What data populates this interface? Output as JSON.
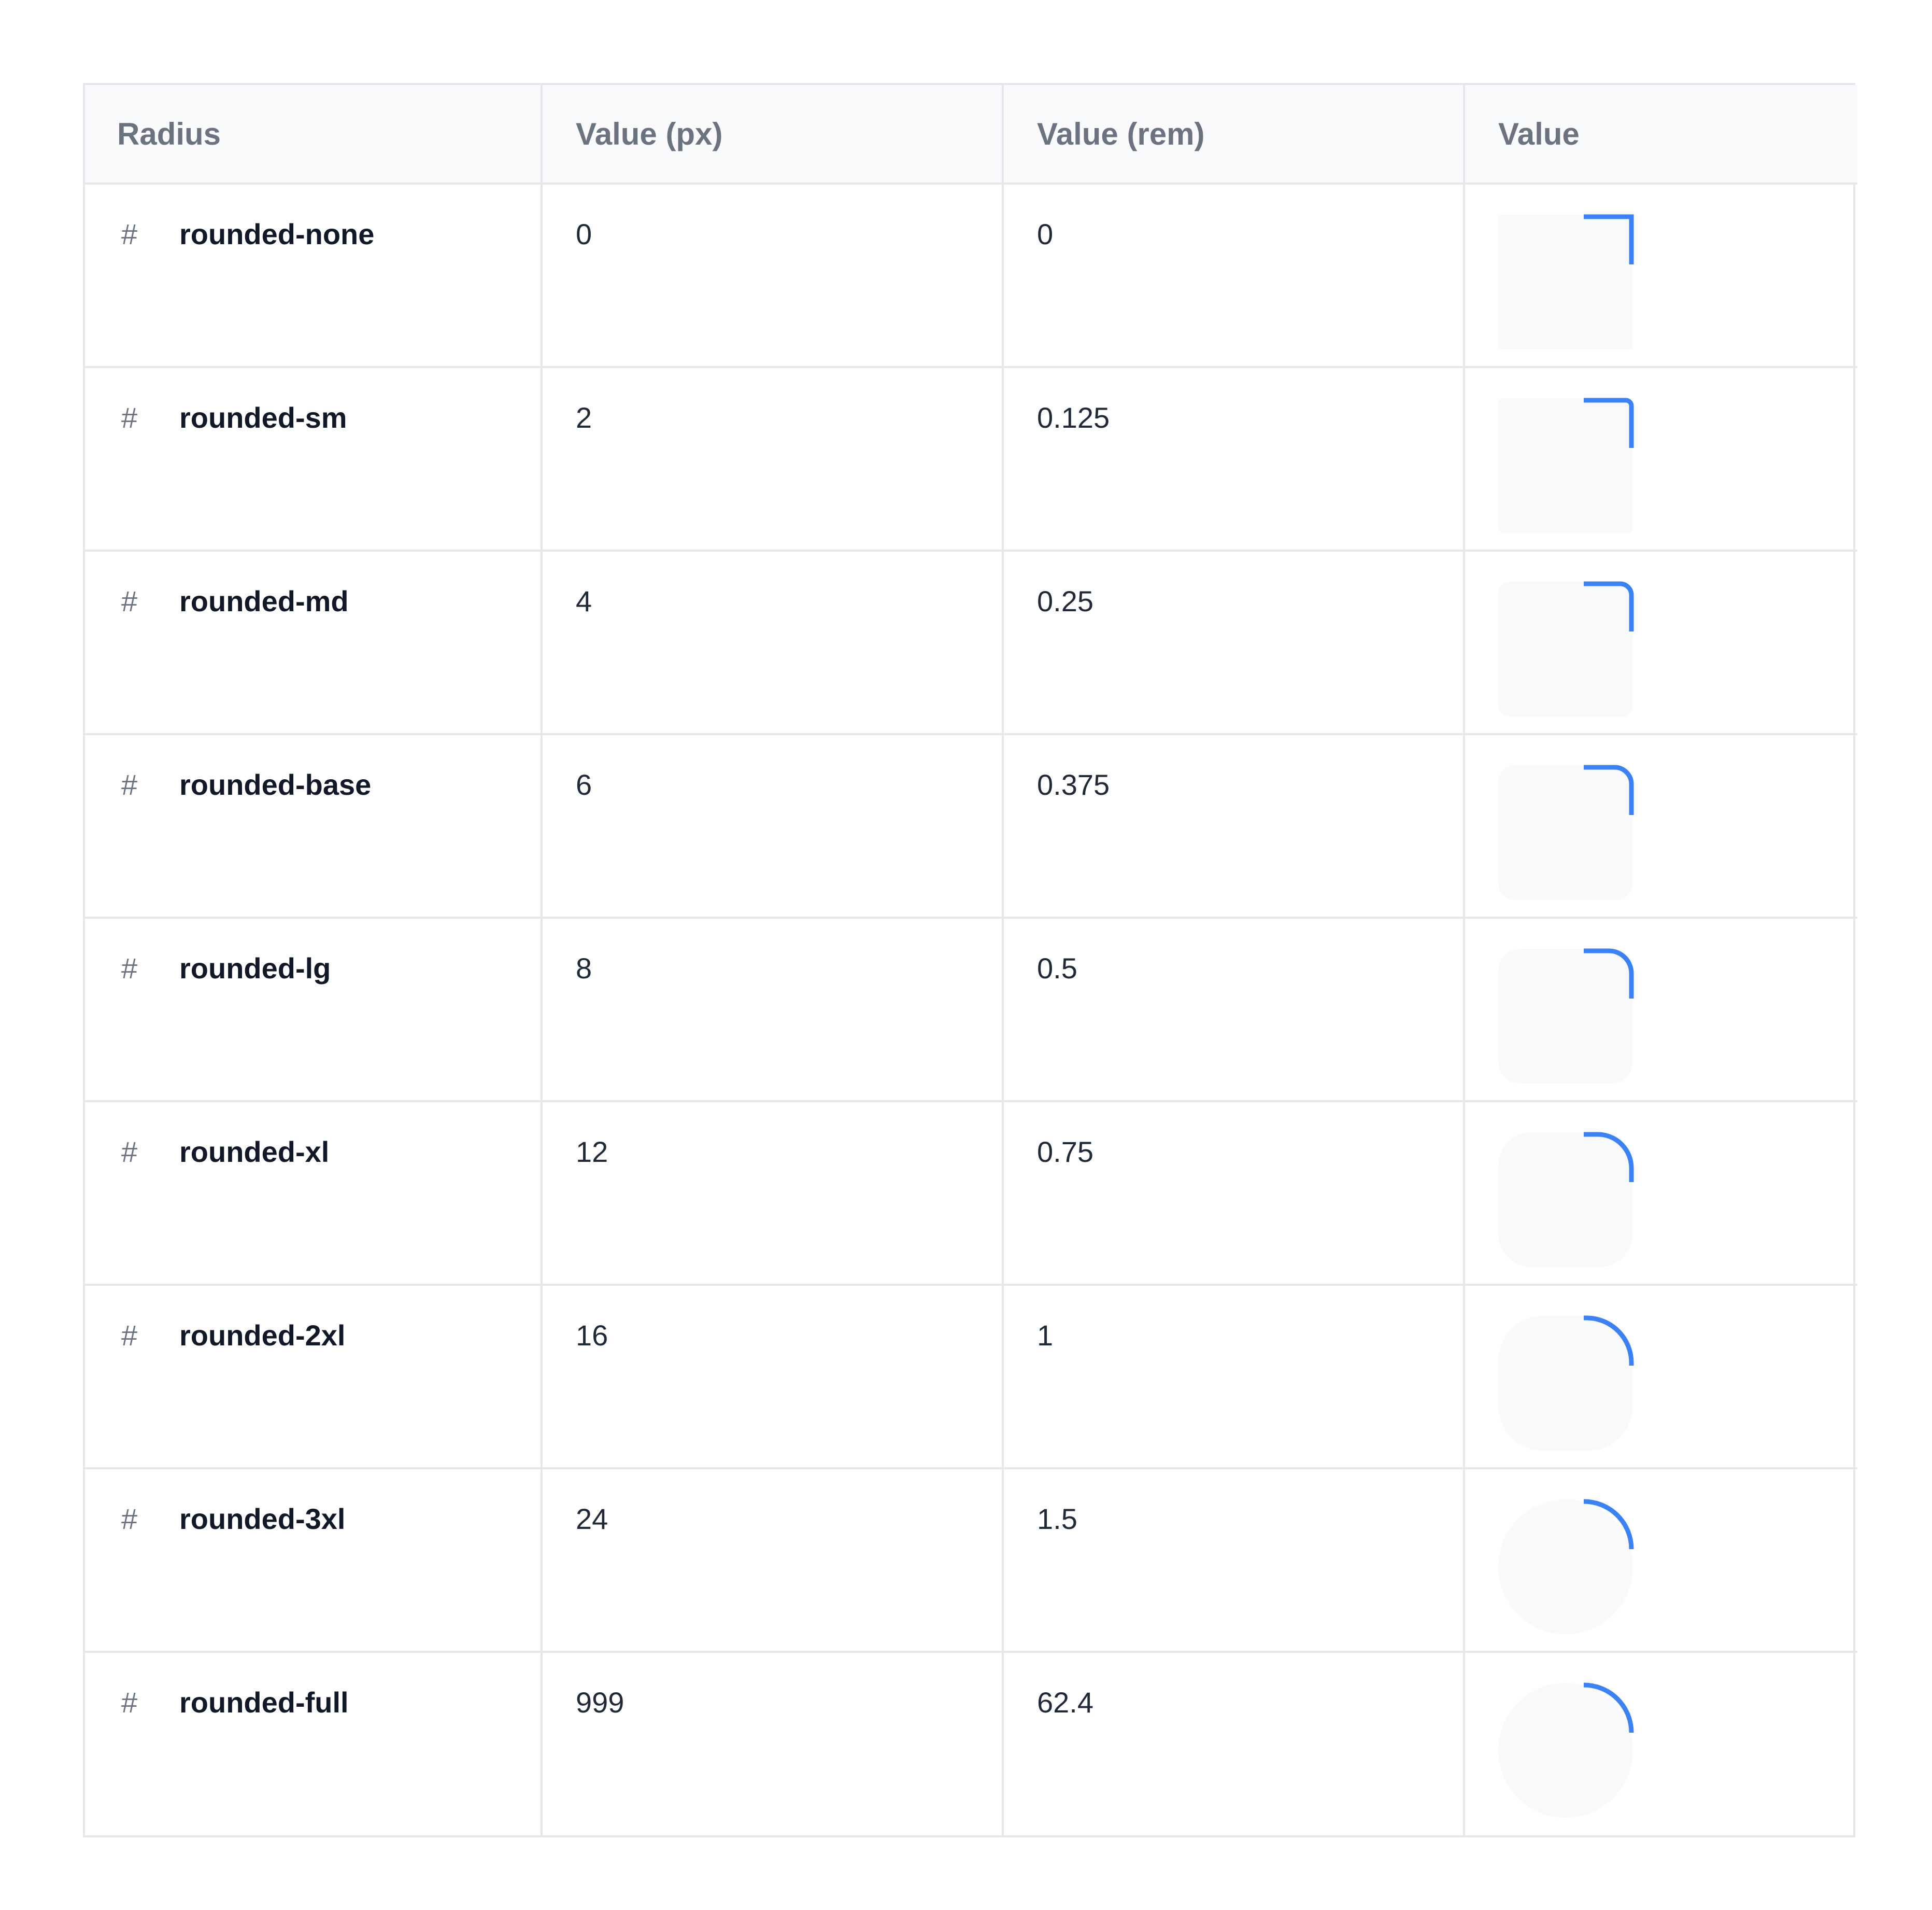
{
  "table": {
    "headers": [
      "Radius",
      "Value (px)",
      "Value (rem)",
      "Value"
    ],
    "anchor_symbol": "#",
    "rows": [
      {
        "name": "rounded-none",
        "px": "0",
        "rem": "0",
        "radius": 0
      },
      {
        "name": "rounded-sm",
        "px": "2",
        "rem": "0.125",
        "radius": 2
      },
      {
        "name": "rounded-md",
        "px": "4",
        "rem": "0.25",
        "radius": 4
      },
      {
        "name": "rounded-base",
        "px": "6",
        "rem": "0.375",
        "radius": 6
      },
      {
        "name": "rounded-lg",
        "px": "8",
        "rem": "0.5",
        "radius": 8
      },
      {
        "name": "rounded-xl",
        "px": "12",
        "rem": "0.75",
        "radius": 12
      },
      {
        "name": "rounded-2xl",
        "px": "16",
        "rem": "1",
        "radius": 16
      },
      {
        "name": "rounded-3xl",
        "px": "24",
        "rem": "1.5",
        "radius": 24
      },
      {
        "name": "rounded-full",
        "px": "999",
        "rem": "62.4",
        "radius": 999
      }
    ]
  },
  "colors": {
    "accent": "#3b82f6",
    "swatch_fill": "#f8f9fb",
    "border": "#e5e7eb",
    "header_bg": "#f9fafb",
    "header_text": "#6b7280"
  }
}
